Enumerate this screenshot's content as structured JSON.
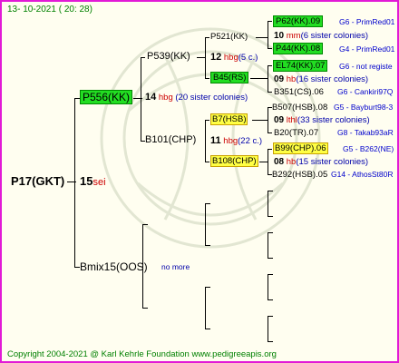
{
  "date": "13- 10-2021 ( 20: 28)",
  "copyright": "Copyright 2004-2021 @ Karl Kehrle Foundation   www.pedigreeapis.org",
  "root": {
    "name": "P17(GKT)",
    "num": "15",
    "suffix": "sei"
  },
  "gen1": [
    {
      "name": "P556(KK)",
      "num": "14",
      "unit": "hbg",
      "note": "(20 sister colonies)"
    },
    {
      "name": "Bmix15(OOS)",
      "note": "no more"
    }
  ],
  "gen2": [
    {
      "name": "P539(KK)",
      "num": "12",
      "unit": "hbg",
      "note": "(5 c.)"
    },
    {
      "name": "B101(CHP)",
      "num": "11",
      "unit": "hbg",
      "note": "(22 c.)"
    }
  ],
  "gen3": [
    {
      "name": "P521(KK)",
      "num": "10",
      "unit": "mm",
      "note": "(6 sister colonies)"
    },
    {
      "name": "B45(RS)"
    },
    {
      "name": "B7(HSB)",
      "num": "09",
      "unit": "lthl",
      "note": "(33 sister colonies)"
    },
    {
      "name": "B108(CHP)",
      "num": "08",
      "unit": "hb",
      "note": "(15 sister colonies)"
    }
  ],
  "gen4": [
    {
      "name": "P62(KK).09",
      "loc": "G6 - PrimRed01"
    },
    {
      "name": "P44(KK).08",
      "loc": "G4 - PrimRed01"
    },
    {
      "name": "EL74(KK).07",
      "loc": "G6 - not registe"
    },
    {
      "name": "B351(CS).06",
      "loc": "G6 - Cankiri97Q"
    },
    {
      "name": "B507(HSB).08",
      "loc": "G5 - Bayburt98-3"
    },
    {
      "name": "B20(TR).07",
      "loc": "G8 - Takab93aR"
    },
    {
      "name": "B99(CHP).06",
      "loc": "G5 - B262(NE)"
    },
    {
      "name": "B292(HSB).05",
      "loc": "G14 - AthosSt80R"
    }
  ],
  "gen4_mid": [
    {
      "num": "09",
      "unit": "hb",
      "note": "(16 sister colonies)"
    }
  ]
}
